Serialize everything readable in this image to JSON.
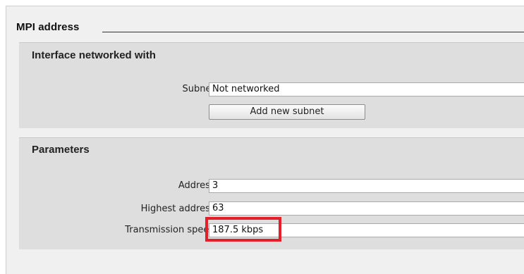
{
  "section": {
    "title": "MPI address"
  },
  "interface_group": {
    "title": "Interface networked with",
    "subnet_label": "Subnet:",
    "subnet_value": "Not networked",
    "add_subnet_label": "Add new subnet"
  },
  "parameters_group": {
    "title": "Parameters",
    "address_label": "Address:",
    "address_value": "3",
    "highest_address_label": "Highest address:",
    "highest_address_value": "63",
    "transmission_speed_label": "Transmission speed:",
    "transmission_speed_value": "187.5 kbps"
  },
  "annotation": {
    "highlight_color": "#e3202a"
  }
}
